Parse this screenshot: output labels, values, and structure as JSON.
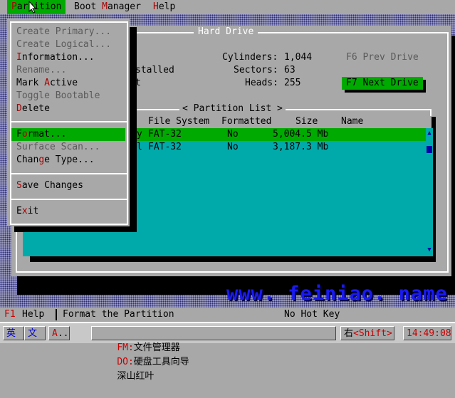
{
  "menubar": {
    "items": [
      {
        "label": "Partition",
        "active": true
      },
      {
        "label": "Boot Manager",
        "active": false
      },
      {
        "label": "Help",
        "active": false
      }
    ]
  },
  "partition_menu": {
    "items": [
      {
        "label": "Create Primary...",
        "disabled": true
      },
      {
        "label": "Create Logical...",
        "disabled": true
      },
      {
        "label": "Information...",
        "disabled": false
      },
      {
        "label": "Rename...",
        "disabled": true
      },
      {
        "label": "Mark Active",
        "disabled": false
      },
      {
        "label": "Toggle Bootable",
        "disabled": true
      },
      {
        "label": "Delete",
        "disabled": false
      },
      {
        "label": "Format...",
        "disabled": false,
        "selected": true
      },
      {
        "label": "Surface Scan...",
        "disabled": true
      },
      {
        "label": "Change Type...",
        "disabled": false
      },
      {
        "label": "Save Changes",
        "disabled": false
      },
      {
        "label": "Exit",
        "disabled": false
      }
    ]
  },
  "hard_drive": {
    "title": "Hard Drive",
    "partial_label_1": "stalled",
    "partial_label_2": "t",
    "cylinders_label": "Cylinders:",
    "cylinders_value": "1,044",
    "sectors_label": "Sectors:",
    "sectors_value": "63",
    "heads_label": "Heads:",
    "heads_value": "255",
    "prev_drive": "F6 Prev Drive",
    "next_drive": "F7 Next Drive"
  },
  "partition_list": {
    "title": "< Partition List >",
    "columns": [
      "File System",
      "Formatted",
      "Size",
      "Name"
    ],
    "rows": [
      {
        "lead": "y",
        "file_system": "FAT-32",
        "formatted": "No",
        "size": "5,004.5 Mb",
        "name": "",
        "selected": true
      },
      {
        "lead": "l",
        "file_system": "FAT-32",
        "formatted": "No",
        "size": "3,187.3 Mb",
        "name": "",
        "selected": false
      }
    ]
  },
  "brand_text": "www. feiniao. name",
  "status_bar": {
    "help_key": "F1",
    "help_label": "Help",
    "hint": "Format the Partition",
    "hot_key": "No Hot Key"
  },
  "taskbar": {
    "input_lang": "英",
    "input_mode": "文",
    "indicator": "A",
    "dots": "..",
    "fm_key": "FM:",
    "fm_label": "文件管理器",
    "do_key": "DO:",
    "do_label": "硬盘工具向导",
    "extra_label": "深山红叶",
    "right_label": "右",
    "shift_key": "<Shift>",
    "clock": "14:49:08"
  },
  "colors": {
    "selection": "#00aa00",
    "panel": "#a8a8a8",
    "list_bg": "#00aaaa",
    "hotkey": "#aa0000"
  }
}
